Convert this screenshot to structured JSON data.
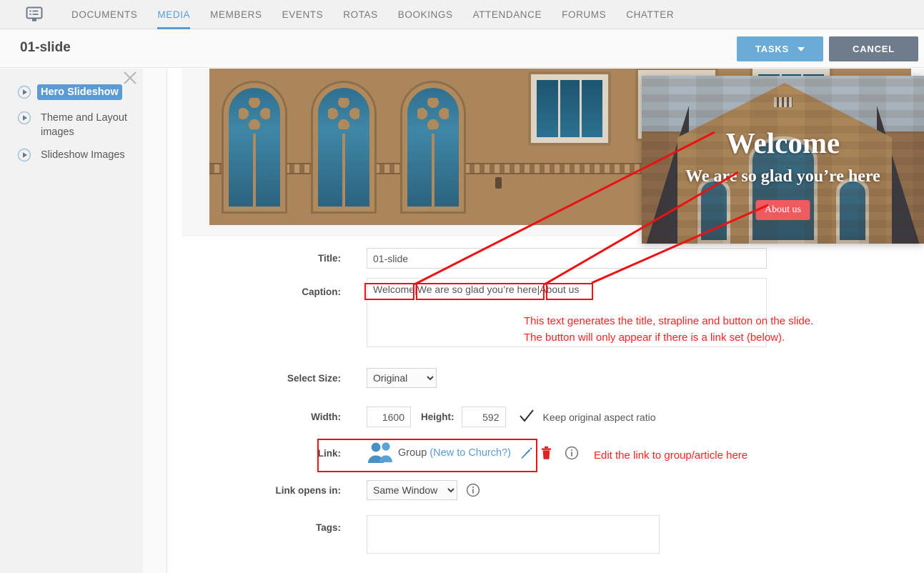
{
  "nav": {
    "logo_icon": "screen-list-icon",
    "items": [
      {
        "label": "DOCUMENTS",
        "active": false
      },
      {
        "label": "MEDIA",
        "active": true
      },
      {
        "label": "MEMBERS",
        "active": false
      },
      {
        "label": "EVENTS",
        "active": false
      },
      {
        "label": "ROTAS",
        "active": false
      },
      {
        "label": "BOOKINGS",
        "active": false
      },
      {
        "label": "ATTENDANCE",
        "active": false
      },
      {
        "label": "FORUMS",
        "active": false
      },
      {
        "label": "CHATTER",
        "active": false
      }
    ]
  },
  "header": {
    "title": "01-slide",
    "tasks_label": "TASKS",
    "cancel_label": "CANCEL",
    "tasks_color": "#6aabd8",
    "cancel_color": "#6f7c8b"
  },
  "sidebar": {
    "close_icon": "close-icon",
    "items": [
      {
        "label": "Hero Slideshow",
        "selected": true,
        "icon": "play-circle-icon"
      },
      {
        "label": "Theme and Layout images",
        "selected": false,
        "icon": "play-circle-icon"
      },
      {
        "label": "Slideshow Images",
        "selected": false,
        "icon": "play-circle-icon"
      }
    ]
  },
  "slide_preview": {
    "title": "Welcome",
    "strapline": "We are so glad you’re here",
    "button_label": "About us",
    "button_color": "#ef5a5f"
  },
  "form": {
    "title": {
      "label": "Title:",
      "value": "01-slide"
    },
    "caption": {
      "label": "Caption:",
      "segments": [
        "Welcome",
        "We are so glad you’re here",
        "About us"
      ],
      "separator": "|",
      "value": "Welcome|We are so glad you’re here|About us"
    },
    "select_size": {
      "label": "Select Size:",
      "value": "Original",
      "options": [
        "Original"
      ]
    },
    "width": {
      "label": "Width:",
      "value": "1600"
    },
    "height": {
      "label": "Height:",
      "value": "592"
    },
    "aspect": {
      "label": "Keep original aspect ratio",
      "checked": true,
      "icon": "check-icon"
    },
    "link": {
      "label": "Link:",
      "icon": "group-people-icon",
      "type_text": "Group",
      "target_text": "(New to Church?)",
      "edit_icon": "pencil-icon",
      "delete_icon": "trash-icon",
      "info_icon": "info-icon"
    },
    "link_opens_in": {
      "label": "Link opens in:",
      "value": "Same Window",
      "options": [
        "Same Window"
      ],
      "info_icon": "info-icon"
    },
    "tags": {
      "label": "Tags:",
      "value": "",
      "placeholder": ""
    }
  },
  "annotations": {
    "color": "#fb2222",
    "caption_note_line1": "This text generates the title, strapline and button on the slide.",
    "caption_note_line2": "The button will only appear if there is a link set (below).",
    "link_note": "Edit the link to group/article here"
  }
}
